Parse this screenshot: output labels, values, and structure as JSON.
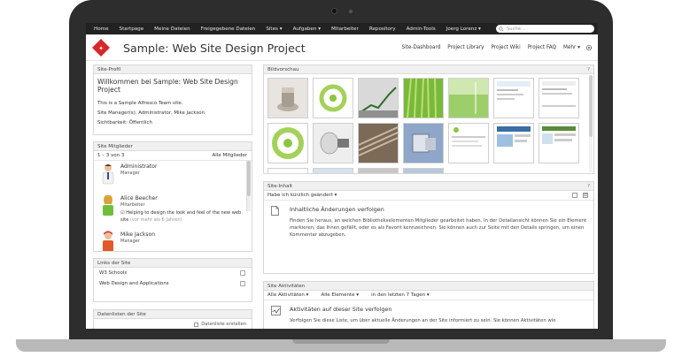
{
  "topnav": {
    "items": [
      "Home",
      "Startpage",
      "Meine Dateien",
      "Freigegebene Dateien",
      "Sites ▾",
      "Aufgaben ▾",
      "Mitarbeiter",
      "Repository",
      "Admin-Tools",
      "Joerg Lorenz ▾"
    ],
    "search_placeholder": "Suche..."
  },
  "site": {
    "title": "Sample: Web Site Design Project",
    "links": [
      "Site-Dashboard",
      "Project Library",
      "Project Wiki",
      "Project FAQ",
      "Mehr ▾"
    ]
  },
  "profile": {
    "title": "Site-Profil",
    "welcome": "Willkommen bei Sample: Web Site Design Project",
    "description": "This is a Sample Alfresco Team site.",
    "managers": "Site Manager(s): Administrator, Mike Jackson",
    "visibility": "Sichtbarkeit: Öffentlich"
  },
  "members": {
    "title": "Site Mitglieder",
    "count": "1 – 3 von 3",
    "all_label": "Alle Mitglieder",
    "list": [
      {
        "name": "Administrator",
        "role": "Manager",
        "status": "",
        "status_meta": ""
      },
      {
        "name": "Alice Beecher",
        "role": "Mitarbeiter",
        "status": "Helping to design the look and feel of the new web site",
        "status_meta": "(vor mehr als 6 Jahren)"
      },
      {
        "name": "Mike Jackson",
        "role": "Manager",
        "status": "",
        "status_meta": ""
      }
    ]
  },
  "links": {
    "title": "Links der Site",
    "items": [
      "W3 Schools",
      "Web Design and Applications"
    ]
  },
  "datalists": {
    "title": "Datenlisten der Site",
    "create_label": "Datenliste erstellen"
  },
  "preview": {
    "title": "Bildvorschau",
    "help": "?"
  },
  "content": {
    "title": "Site-Inhalt",
    "help": "?",
    "filter": "Habe ich kürzlich geändert ▾",
    "heading": "Inhaltliche Änderungen verfolgen",
    "text": "Finden Sie heraus, an welchen Bibliothekselementen Mitglieder gearbeitet haben. In der Detailansicht können Sie ein Element markieren, das Ihnen gefällt, oder es als Favorit kennzeichnen. Sie können auch zur Seite mit den Details springen, um einen Kommentar abzugeben."
  },
  "activities": {
    "title": "Site Aktivitäten",
    "filters": [
      "Alle Aktivitäten ▾",
      "Alle Elemente ▾",
      "in den letzten 7 Tagen ▾"
    ],
    "heading": "Aktivitäten auf dieser Site verfolgen",
    "text": "Verfolgen Sie diese Liste, um über aktuelle Änderungen an der Site informiert zu sein. Sie können Aktivitäten wie"
  },
  "colors": {
    "topnav_bg": "#222222",
    "brand_red": "#d8262b",
    "laptop_frame": "#2d2d2d"
  }
}
